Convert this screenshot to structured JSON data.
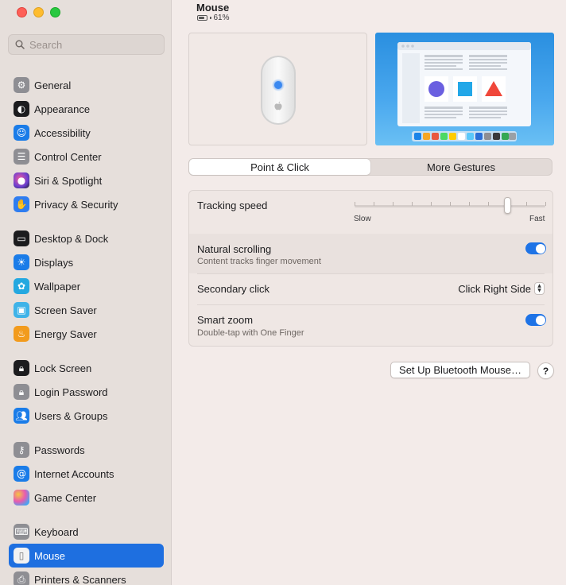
{
  "window": {
    "title": "Mouse"
  },
  "search": {
    "placeholder": "Search"
  },
  "sidebar": {
    "items": [
      {
        "label": "General",
        "icon": "gear-icon",
        "color": "#8e8e93",
        "selected": false
      },
      {
        "label": "Appearance",
        "icon": "appearance-icon",
        "color": "#1c1c1e",
        "selected": false
      },
      {
        "label": "Accessibility",
        "icon": "accessibility-icon",
        "color": "#1a7ce8",
        "selected": false
      },
      {
        "label": "Control Center",
        "icon": "control-center-icon",
        "color": "#8e8e93",
        "selected": false
      },
      {
        "label": "Siri & Spotlight",
        "icon": "siri-icon",
        "color": "#6a3fd0",
        "selected": false
      },
      {
        "label": "Privacy & Security",
        "icon": "hand-icon",
        "color": "#2f7df0",
        "selected": false
      },
      {
        "label": "Desktop & Dock",
        "icon": "dock-icon",
        "color": "#1c1c1e",
        "selected": false
      },
      {
        "label": "Displays",
        "icon": "sun-icon",
        "color": "#1a7ce8",
        "selected": false
      },
      {
        "label": "Wallpaper",
        "icon": "flower-icon",
        "color": "#24a8e0",
        "selected": false
      },
      {
        "label": "Screen Saver",
        "icon": "screensaver-icon",
        "color": "#3fb3e8",
        "selected": false
      },
      {
        "label": "Energy Saver",
        "icon": "bulb-icon",
        "color": "#f29b1d",
        "selected": false
      },
      {
        "label": "Lock Screen",
        "icon": "lock-icon",
        "color": "#1c1c1e",
        "selected": false
      },
      {
        "label": "Login Password",
        "icon": "lock-icon",
        "color": "#8e8e93",
        "selected": false
      },
      {
        "label": "Users & Groups",
        "icon": "users-icon",
        "color": "#1a7ce8",
        "selected": false
      },
      {
        "label": "Passwords",
        "icon": "key-icon",
        "color": "#8e8e93",
        "selected": false
      },
      {
        "label": "Internet Accounts",
        "icon": "at-icon",
        "color": "#1a7ce8",
        "selected": false
      },
      {
        "label": "Game Center",
        "icon": "game-center-icon",
        "color": "#e85ab0",
        "selected": false
      },
      {
        "label": "Keyboard",
        "icon": "keyboard-icon",
        "color": "#8e8e93",
        "selected": false
      },
      {
        "label": "Mouse",
        "icon": "mouse-icon",
        "color": "#8e8e93",
        "selected": true
      },
      {
        "label": "Printers & Scanners",
        "icon": "printer-icon",
        "color": "#8e8e93",
        "selected": false
      }
    ]
  },
  "device": {
    "name": "Mouse",
    "battery_text": "61%",
    "battery_level": 0.61
  },
  "tabs": [
    {
      "label": "Point & Click",
      "active": true
    },
    {
      "label": "More Gestures",
      "active": false
    }
  ],
  "settings": {
    "tracking_speed": {
      "label": "Tracking speed",
      "min_label": "Slow",
      "max_label": "Fast",
      "value": 0.8,
      "ticks": 11
    },
    "natural_scrolling": {
      "label": "Natural scrolling",
      "sublabel": "Content tracks finger movement",
      "on": true
    },
    "secondary_click": {
      "label": "Secondary click",
      "value": "Click Right Side"
    },
    "smart_zoom": {
      "label": "Smart zoom",
      "sublabel": "Double-tap with One Finger",
      "on": true
    }
  },
  "buttons": {
    "bluetooth": "Set Up Bluetooth Mouse…",
    "help": "?"
  },
  "colors": {
    "accent": "#1e6fe0",
    "toggle_on": "#1e73e6"
  }
}
